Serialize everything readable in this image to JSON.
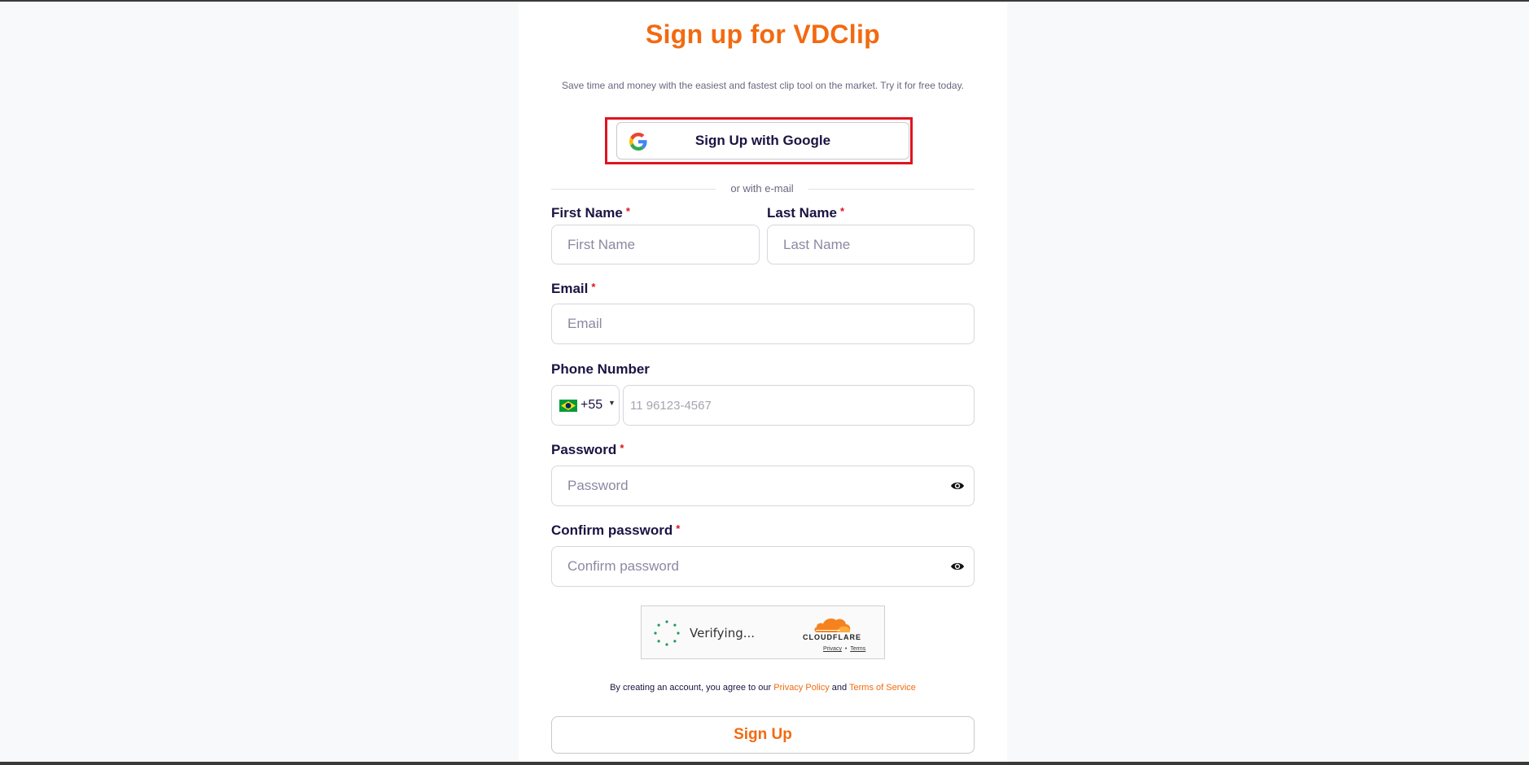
{
  "header": {
    "title": "Sign up for VDClip",
    "subtitle": "Save time and money with the easiest and fastest clip tool on the market. Try it for free today."
  },
  "google_button": {
    "label": "Sign Up with Google"
  },
  "divider": {
    "text": "or with e-mail"
  },
  "form": {
    "first_name": {
      "label": "First Name",
      "required_mark": "*",
      "placeholder": "First Name",
      "value": ""
    },
    "last_name": {
      "label": "Last Name",
      "required_mark": "*",
      "placeholder": "Last Name",
      "value": ""
    },
    "email": {
      "label": "Email",
      "required_mark": "*",
      "placeholder": "Email",
      "value": ""
    },
    "phone": {
      "label": "Phone Number",
      "country_code": "+55",
      "country_flag": "brazil-flag-icon",
      "placeholder": "11 96123-4567",
      "value": ""
    },
    "password": {
      "label": "Password",
      "required_mark": "*",
      "placeholder": "Password",
      "value": ""
    },
    "confirm_password": {
      "label": "Confirm password",
      "required_mark": "*",
      "placeholder": "Confirm password",
      "value": ""
    }
  },
  "captcha": {
    "status": "Verifying...",
    "brand": "CLOUDFLARE",
    "privacy_link": "Privacy",
    "separator": "•",
    "terms_link": "Terms"
  },
  "agreement": {
    "prefix": "By creating an account, you agree to our ",
    "privacy_policy": "Privacy Policy",
    "and": " and ",
    "terms_of_service": "Terms of Service"
  },
  "submit": {
    "label": "Sign Up"
  },
  "colors": {
    "accent": "#f26a10",
    "text": "#1b1342",
    "required": "#e0141e",
    "highlight": "#e0141e"
  }
}
